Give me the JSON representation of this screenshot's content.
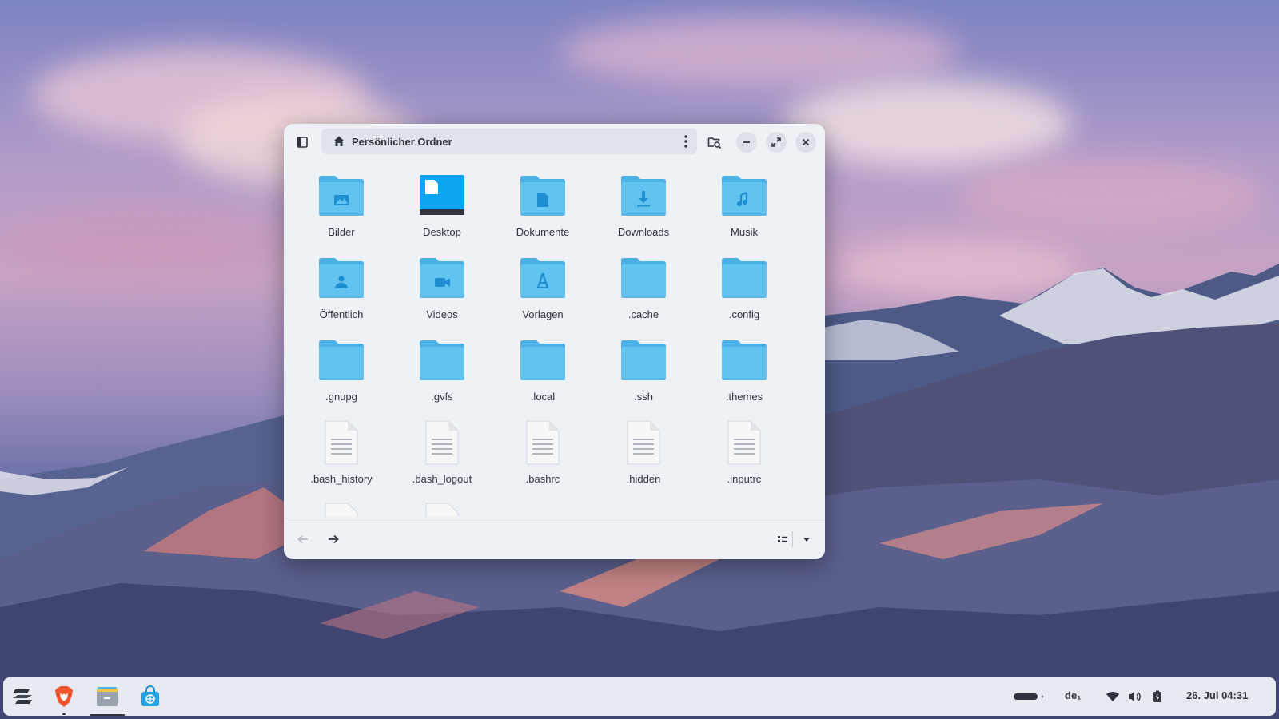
{
  "window": {
    "path_label": "Persönlicher Ordner"
  },
  "items": [
    {
      "label": "Bilder",
      "type": "folder",
      "icon": "image-icon"
    },
    {
      "label": "Desktop",
      "type": "desktop",
      "icon": "desktop-icon"
    },
    {
      "label": "Dokumente",
      "type": "folder",
      "icon": "document-icon"
    },
    {
      "label": "Downloads",
      "type": "folder",
      "icon": "download-icon"
    },
    {
      "label": "Musik",
      "type": "folder",
      "icon": "music-icon"
    },
    {
      "label": "Öffentlich",
      "type": "folder",
      "icon": "user-icon"
    },
    {
      "label": "Videos",
      "type": "folder",
      "icon": "video-icon"
    },
    {
      "label": "Vorlagen",
      "type": "folder",
      "icon": "template-icon"
    },
    {
      "label": ".cache",
      "type": "folder",
      "icon": ""
    },
    {
      "label": ".config",
      "type": "folder",
      "icon": ""
    },
    {
      "label": ".gnupg",
      "type": "folder",
      "icon": ""
    },
    {
      "label": ".gvfs",
      "type": "folder",
      "icon": ""
    },
    {
      "label": ".local",
      "type": "folder",
      "icon": ""
    },
    {
      "label": ".ssh",
      "type": "folder",
      "icon": ""
    },
    {
      "label": ".themes",
      "type": "folder",
      "icon": ""
    },
    {
      "label": ".bash_history",
      "type": "file",
      "icon": "text-file-icon"
    },
    {
      "label": ".bash_logout",
      "type": "file",
      "icon": "text-file-icon"
    },
    {
      "label": ".bashrc",
      "type": "file",
      "icon": "text-file-icon"
    },
    {
      "label": ".hidden",
      "type": "file",
      "icon": "text-file-icon"
    },
    {
      "label": ".inputrc",
      "type": "file",
      "icon": "text-file-icon"
    }
  ],
  "taskbar": {
    "keyboard_layout": "de₁",
    "datetime": "26. Jul  04:31"
  },
  "colors": {
    "folder": "#62c3f0",
    "folder_tab": "#4ab0e6",
    "folder_glyph": "#1d8fd0",
    "window_bg": "#eef1f6",
    "accent": "#1d8fd0"
  }
}
